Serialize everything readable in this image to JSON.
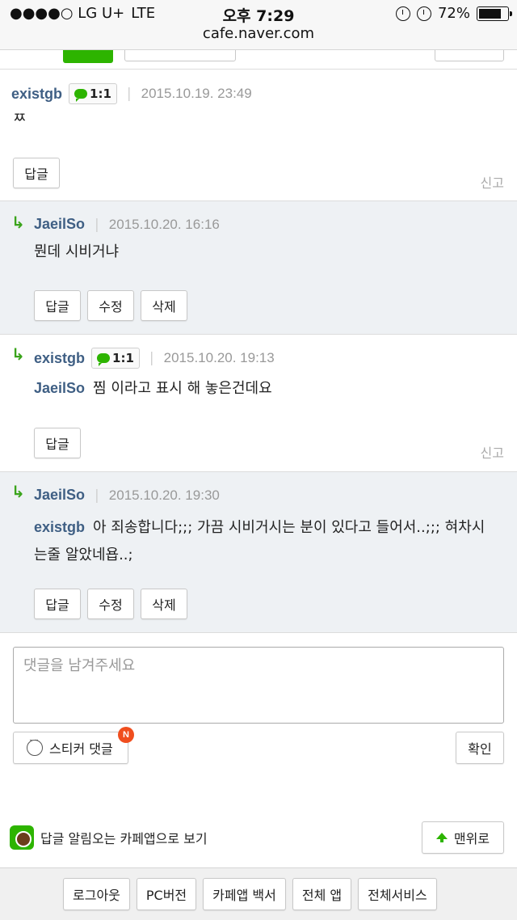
{
  "status_bar": {
    "carrier": "●●●●○ LG U+",
    "network": "LTE",
    "time": "오후 7:29",
    "url": "cafe.naver.com",
    "battery": "72%"
  },
  "comments": [
    {
      "author": "existgb",
      "chat_badge": "1:1",
      "date": "2015.10.19. 23:49",
      "text": "ㅉ",
      "reply_label": "답글",
      "report_label": "신고"
    },
    {
      "author": "JaeilSo",
      "date": "2015.10.20. 16:16",
      "text": "뭔데 시비거냐",
      "reply_label": "답글",
      "edit_label": "수정",
      "delete_label": "삭제"
    },
    {
      "author": "existgb",
      "chat_badge": "1:1",
      "date": "2015.10.20. 19:13",
      "mention": "JaeilSo",
      "text": "찜 이라고 표시 해 놓은건데요",
      "reply_label": "답글",
      "report_label": "신고"
    },
    {
      "author": "JaeilSo",
      "date": "2015.10.20. 19:30",
      "mention": "existgb",
      "text_line1": "아 죄송합니다;;; 가끔 시비거시는 분이 있다고 들어서..;;; 혀차시",
      "text_line2": "는줄 알았네욥..;",
      "reply_label": "답글",
      "edit_label": "수정",
      "delete_label": "삭제"
    }
  ],
  "composer": {
    "placeholder": "댓글을 남겨주세요",
    "sticker_label": "스티커 댓글",
    "new_badge": "N",
    "confirm_label": "확인"
  },
  "cafe_app_link": "답글 알림오는 카페앱으로 보기",
  "top_button": "맨위로",
  "footer": [
    "로그아웃",
    "PC버전",
    "카페앱 백서",
    "전체 앱",
    "전체서비스"
  ]
}
